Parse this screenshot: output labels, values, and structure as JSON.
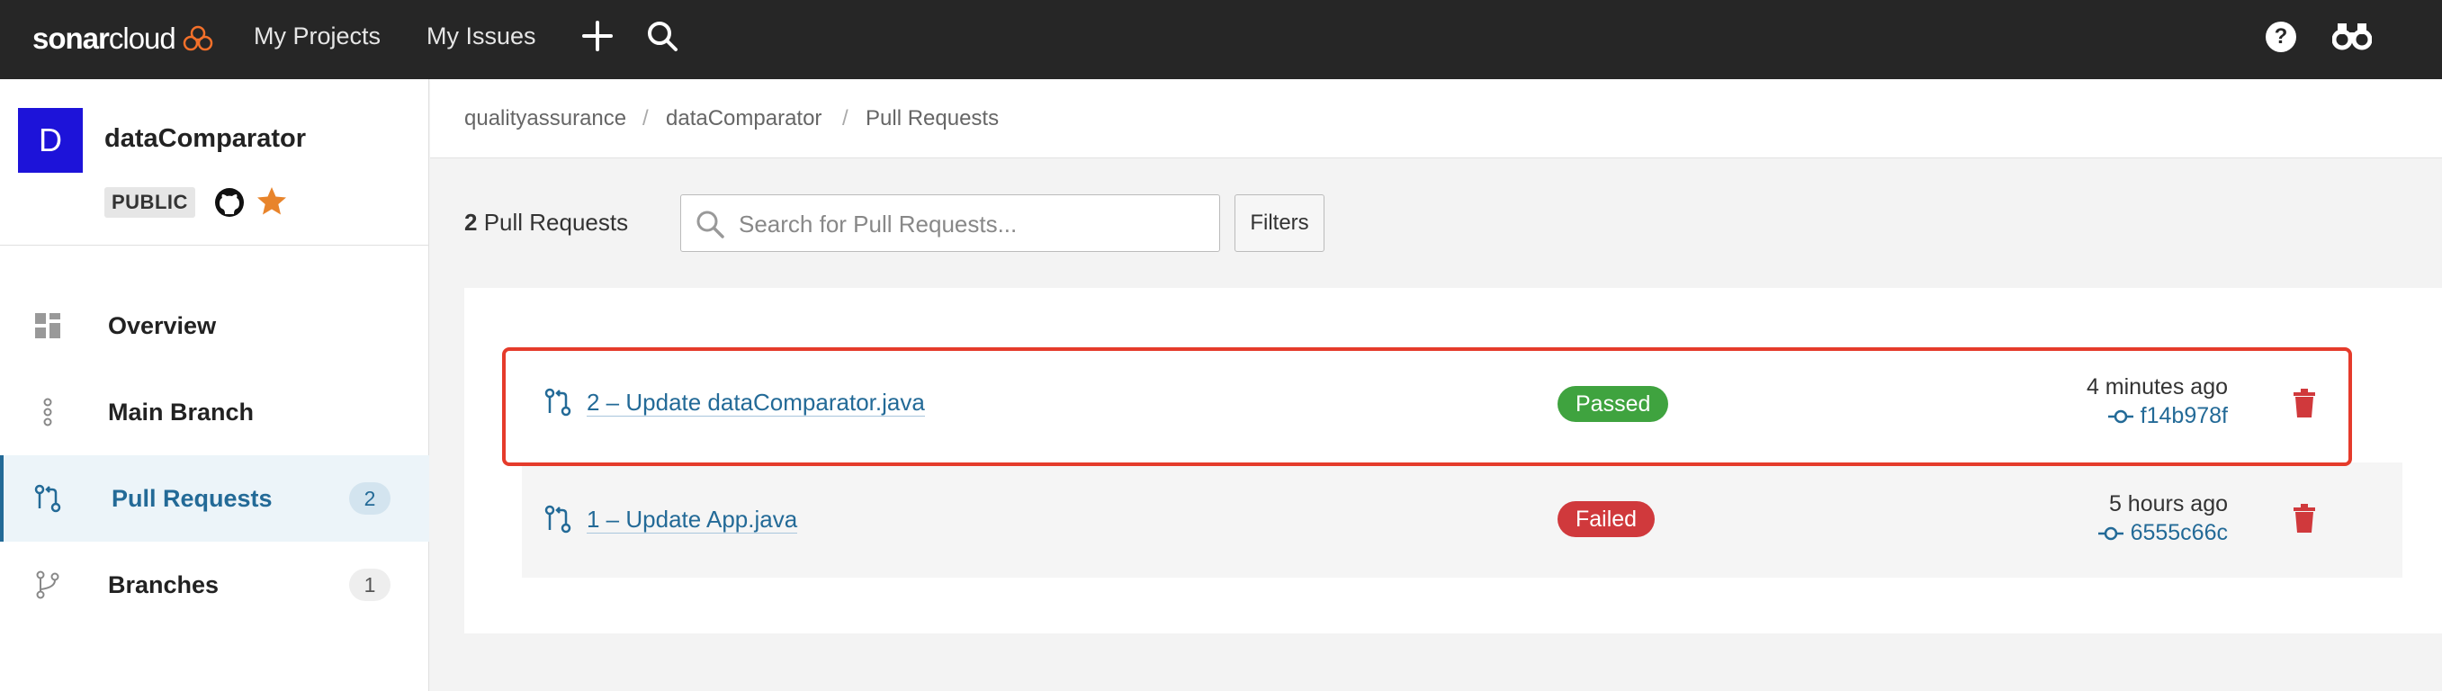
{
  "topbar": {
    "logo_text_a": "sonar",
    "logo_text_b": "cloud",
    "nav": [
      "My Projects",
      "My Issues"
    ],
    "icons": [
      "plus-icon",
      "search-icon",
      "help-icon",
      "binoculars-icon"
    ],
    "help_glyph": "?"
  },
  "project": {
    "avatar_letter": "D",
    "name": "dataComparator",
    "visibility": "PUBLIC",
    "avatar_color": "#1d13d9"
  },
  "sidebar": {
    "items": [
      {
        "label": "Overview",
        "icon": "dashboard-icon",
        "count": null,
        "active": false
      },
      {
        "label": "Main Branch",
        "icon": "branch-line-icon",
        "count": null,
        "active": false
      },
      {
        "label": "Pull Requests",
        "icon": "pull-request-icon",
        "count": "2",
        "active": true
      },
      {
        "label": "Branches",
        "icon": "branches-icon",
        "count": "1",
        "active": false
      }
    ]
  },
  "breadcrumb": [
    "qualityassurance",
    "dataComparator",
    "Pull Requests"
  ],
  "breadcrumb_sep": "/",
  "toolbar": {
    "count_num": "2",
    "count_label": " Pull Requests",
    "search_placeholder": "Search for Pull Requests...",
    "filters_label": "Filters"
  },
  "pull_requests": [
    {
      "title": "2 – Update dataComparator.java",
      "status": "Passed",
      "time": "4 minutes ago",
      "commit": "f14b978f",
      "highlighted": true
    },
    {
      "title": "1 – Update App.java",
      "status": "Failed",
      "time": "5 hours ago",
      "commit": "6555c66c",
      "highlighted": false
    }
  ],
  "colors": {
    "accent": "#236a97",
    "passed": "#3fa33f",
    "failed": "#d0393c",
    "highlight": "#e53b2b",
    "topbar": "#262626"
  }
}
